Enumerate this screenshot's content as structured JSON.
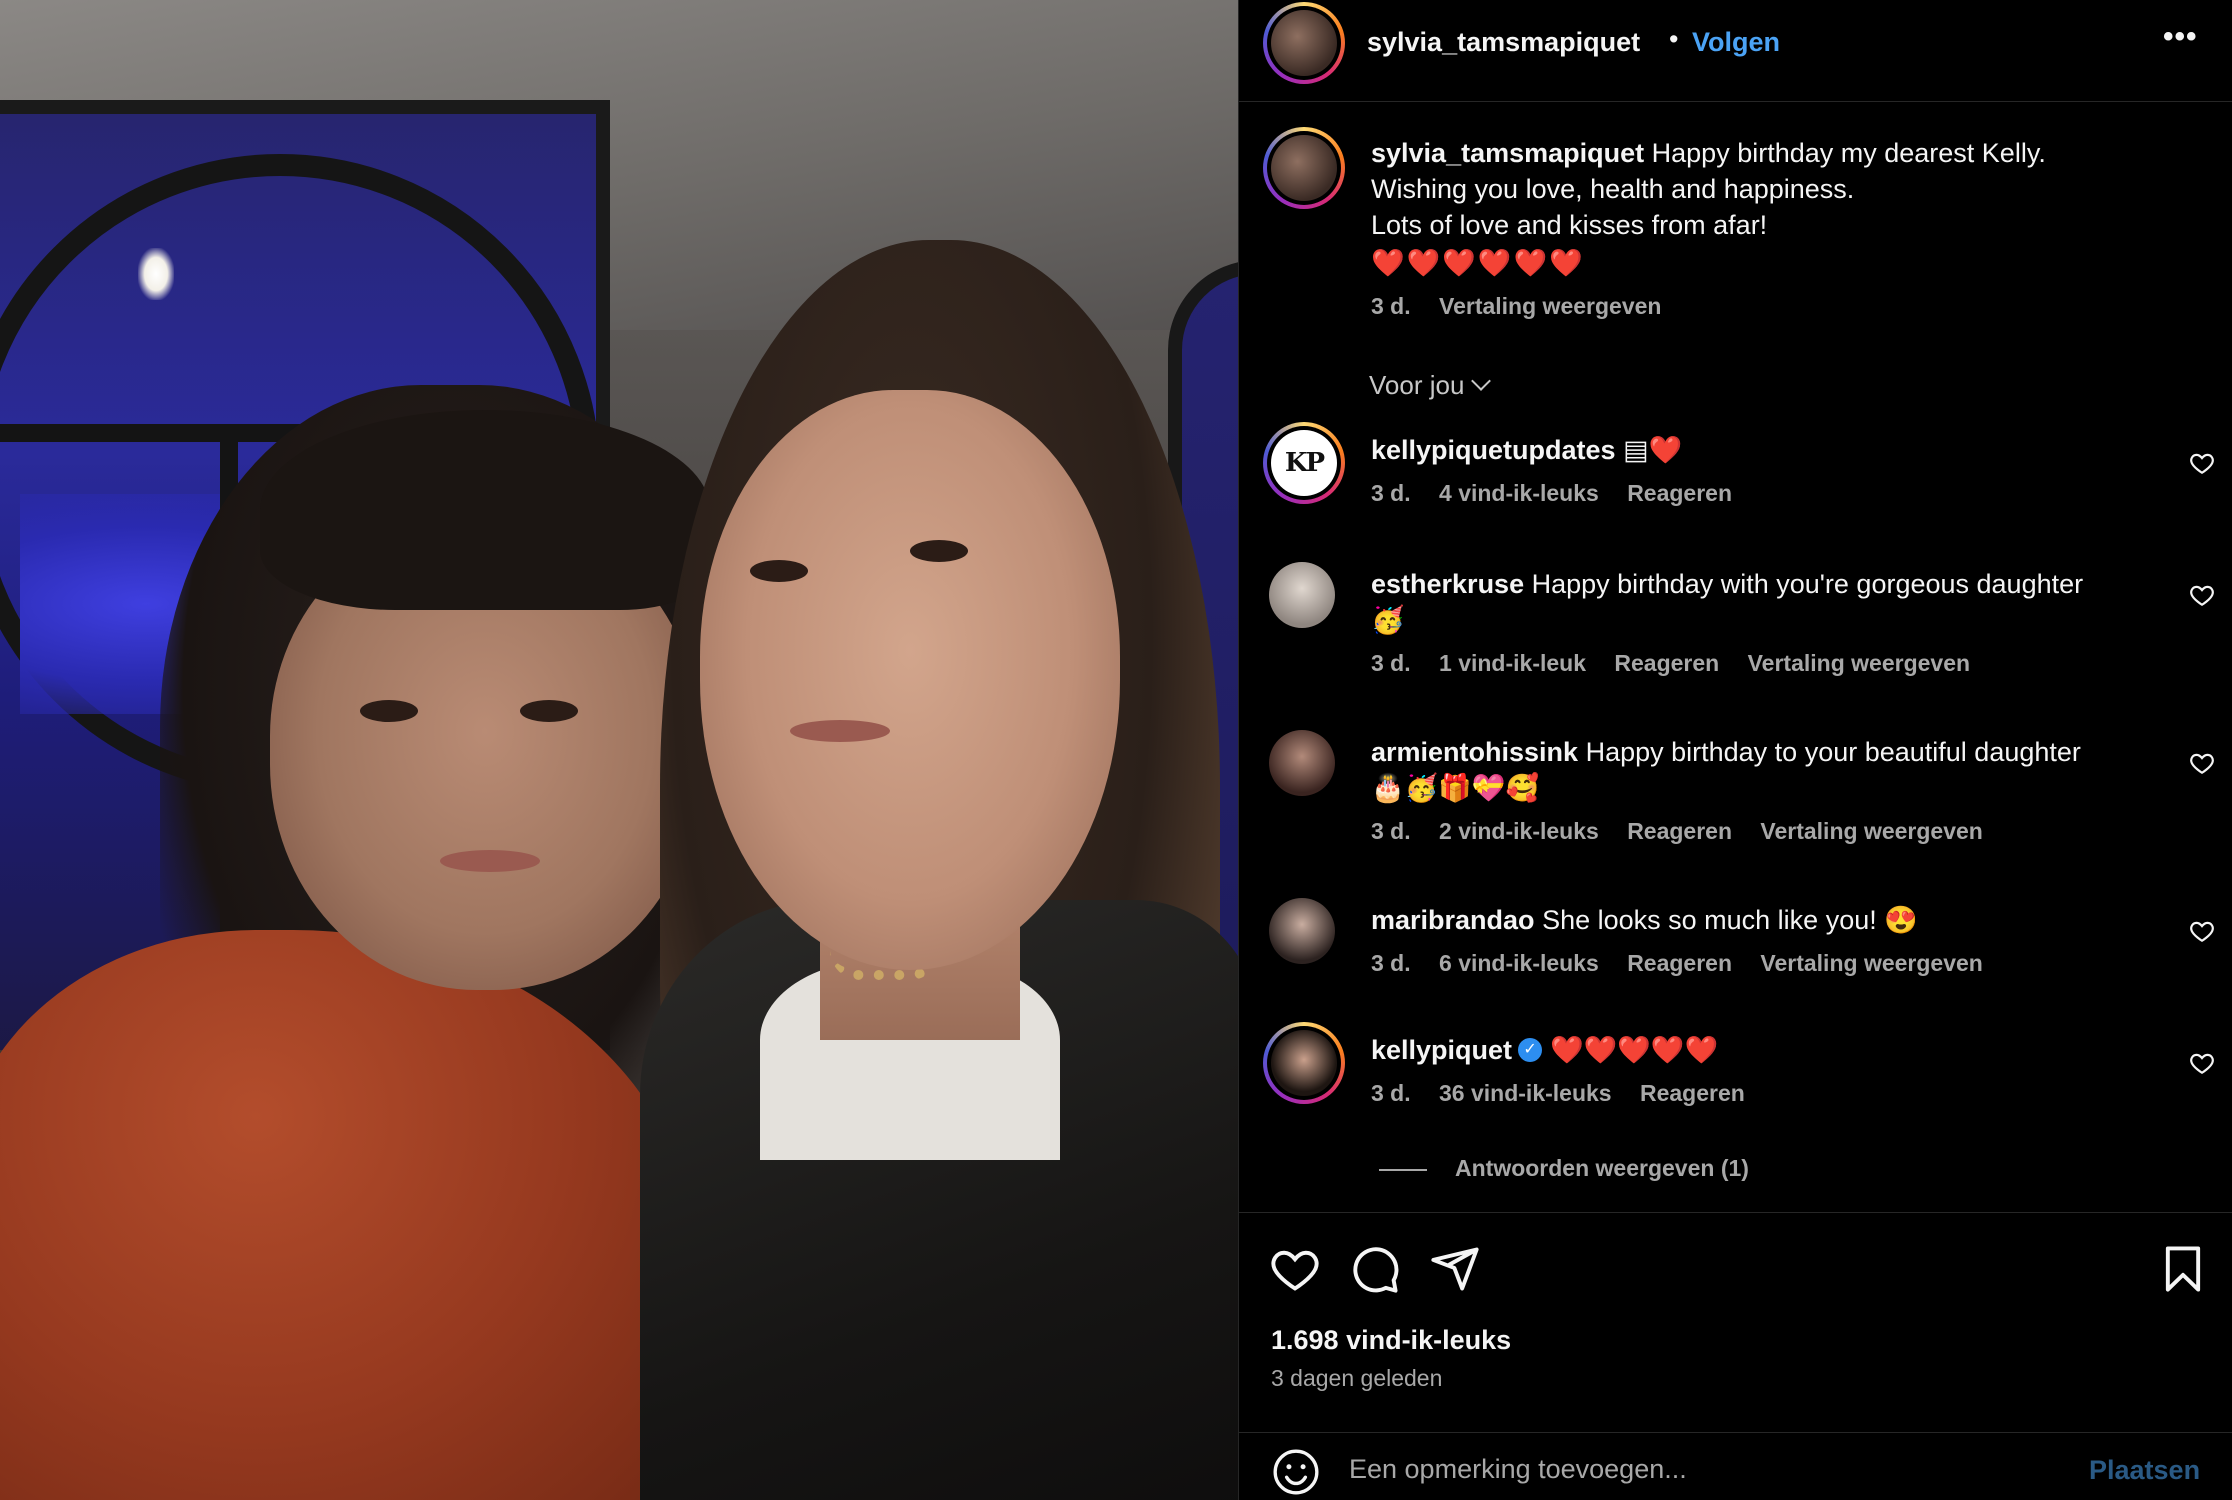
{
  "post": {
    "username": "sylvia_tamsmapiquet",
    "separator": "•",
    "follow_label": "Volgen",
    "more_label": "•••",
    "caption": {
      "username": "sylvia_tamsmapiquet",
      "line1": "Happy birthday my dearest Kelly.",
      "line2": "Wishing you love, health and happiness.",
      "line3": "Lots of love and kisses from afar!",
      "hearts": "❤️❤️❤️❤️❤️❤️",
      "age": "3 d.",
      "translate": "Vertaling weergeven"
    },
    "sort_label": "Voor jou",
    "comments": [
      {
        "username": "kellypiquetupdates",
        "text": "▤❤️",
        "age": "3 d.",
        "likes": "4 vind-ik-leuks",
        "reply": "Reageren",
        "avatar": "KP"
      },
      {
        "username": "estherkruse",
        "text": "Happy birthday with you're gorgeous daughter",
        "text2": "🥳",
        "age": "3 d.",
        "likes": "1 vind-ik-leuk",
        "reply": "Reageren",
        "translate": "Vertaling weergeven"
      },
      {
        "username": "armientohissink",
        "text": "Happy birthday to your beautiful daughter",
        "text2": "🎂🥳🎁💝🥰",
        "age": "3 d.",
        "likes": "2 vind-ik-leuks",
        "reply": "Reageren",
        "translate": "Vertaling weergeven"
      },
      {
        "username": "maribrandao",
        "text": "She looks so much like you! 😍",
        "age": "3 d.",
        "likes": "6 vind-ik-leuks",
        "reply": "Reageren",
        "translate": "Vertaling weergeven"
      },
      {
        "username": "kellypiquet",
        "text": "❤️❤️❤️❤️❤️",
        "age": "3 d.",
        "likes": "36 vind-ik-leuks",
        "reply": "Reageren",
        "verified_mark": "✓"
      }
    ],
    "view_replies": "Antwoorden weergeven (1)",
    "likes_total": "1.698 vind-ik-leuks",
    "posted": "3 dagen geleden",
    "composer": {
      "placeholder": "Een opmerking toevoegen...",
      "post_label": "Plaatsen"
    },
    "colors": {
      "follow": "#4ba3f5",
      "muted": "#a8a8a8",
      "post_disabled": "#2a5a85"
    }
  }
}
